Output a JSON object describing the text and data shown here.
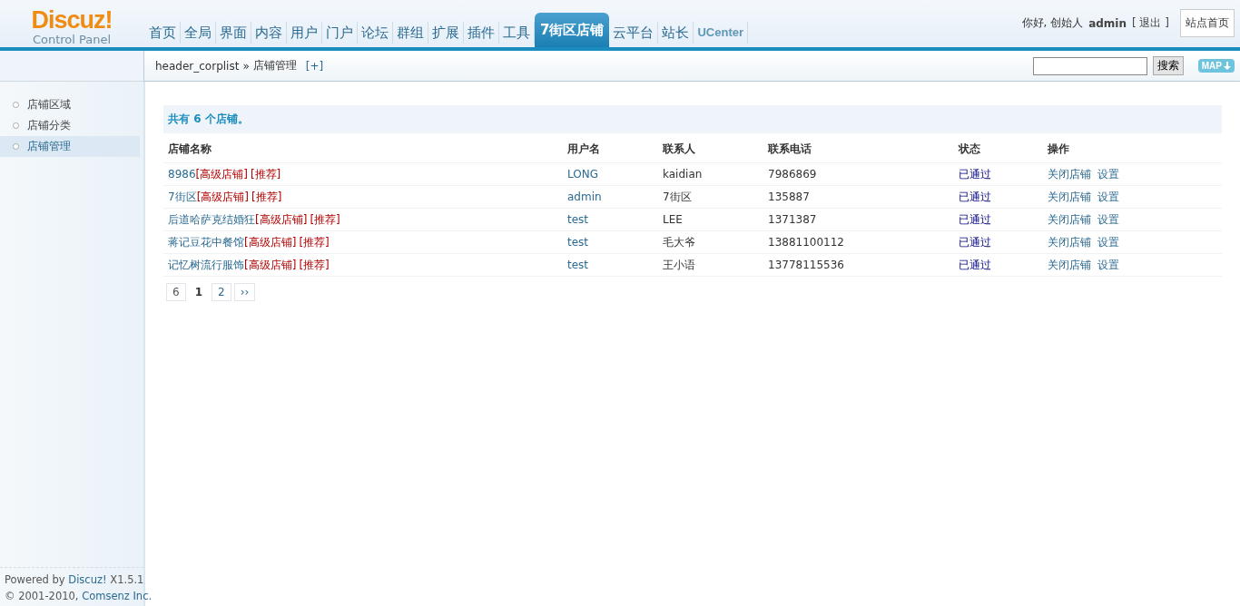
{
  "logo": {
    "title": "Discuz!",
    "subtitle": "Control Panel"
  },
  "nav_tabs": [
    {
      "label": "首页",
      "kind": "menu",
      "selected": false
    },
    {
      "label": "全局",
      "kind": "menu",
      "selected": false
    },
    {
      "label": "界面",
      "kind": "menu",
      "selected": false
    },
    {
      "label": "内容",
      "kind": "menu",
      "selected": false
    },
    {
      "label": "用户",
      "kind": "menu",
      "selected": false
    },
    {
      "label": "门户",
      "kind": "menu",
      "selected": false
    },
    {
      "label": "论坛",
      "kind": "menu",
      "selected": false
    },
    {
      "label": "群组",
      "kind": "menu",
      "selected": false
    },
    {
      "label": "扩展",
      "kind": "menu",
      "selected": false
    },
    {
      "label": "插件",
      "kind": "menu",
      "selected": false
    },
    {
      "label": "工具",
      "kind": "menu",
      "selected": false
    },
    {
      "label": "7街区店铺",
      "kind": "menu",
      "selected": true
    },
    {
      "label": "云平台",
      "kind": "menu",
      "selected": false
    },
    {
      "label": "站长",
      "kind": "menu",
      "selected": false
    },
    {
      "label": "UCenter",
      "kind": "app",
      "selected": false
    }
  ],
  "user_bar": {
    "greeting": "你好, 创始人",
    "username": "admin",
    "logout": "[ 退出 ]",
    "site_home": "站点首页"
  },
  "breadcrumb": {
    "path": "header_corplist",
    "separator": "»",
    "current": "店铺管理",
    "add": "[+]"
  },
  "search": {
    "button": "搜索",
    "map": "MAP"
  },
  "sidebar": {
    "items": [
      {
        "label": "店铺区域",
        "selected": false
      },
      {
        "label": "店铺分类",
        "selected": false
      },
      {
        "label": "店铺管理",
        "selected": true
      }
    ]
  },
  "footer": [
    [
      {
        "text": "Powered by ",
        "link": false
      },
      {
        "text": "Discuz!",
        "link": true
      },
      {
        "text": " X1.5.1",
        "link": false
      }
    ],
    [
      {
        "text": "© 2001-2010, ",
        "link": false
      },
      {
        "text": "Comsenz Inc.",
        "link": true
      }
    ]
  ],
  "summary": "共有 6 个店铺。",
  "table": {
    "columns": [
      "店铺名称",
      "用户名",
      "联系人",
      "联系电话",
      "状态",
      "操作"
    ],
    "rows": [
      {
        "name": "8986",
        "tags": [
          "[高级店铺]",
          "[推荐]"
        ],
        "user": "LONG",
        "contact": "kaidian",
        "phone": "7986869",
        "status": "已通过",
        "actions": [
          "关闭店铺",
          "设置"
        ]
      },
      {
        "name": "7街区",
        "tags": [
          "[高级店铺]",
          "[推荐]"
        ],
        "user": "admin",
        "contact": "7街区",
        "phone": "135887",
        "status": "已通过",
        "actions": [
          "关闭店铺",
          "设置"
        ]
      },
      {
        "name": "后道哈萨克结婚狂",
        "tags": [
          "[高级店铺]",
          "[推荐]"
        ],
        "user": "test",
        "contact": "LEE",
        "phone": "1371387",
        "status": "已通过",
        "actions": [
          "关闭店铺",
          "设置"
        ]
      },
      {
        "name": "蒋记豆花中餐馆",
        "tags": [
          "[高级店铺]",
          "[推荐]"
        ],
        "user": "test",
        "contact": "毛大爷",
        "phone": "13881100112",
        "status": "已通过",
        "actions": [
          "关闭店铺",
          "设置"
        ]
      },
      {
        "name": "记忆树流行服饰",
        "tags": [
          "[高级店铺]",
          "[推荐]"
        ],
        "user": "test",
        "contact": "王小语",
        "phone": "13778115536",
        "status": "已通过",
        "actions": [
          "关闭店铺",
          "设置"
        ]
      }
    ]
  },
  "pagination": {
    "total": "6",
    "pages": [
      {
        "label": "1",
        "selected": true
      },
      {
        "label": "2",
        "selected": false
      }
    ],
    "next": "››"
  }
}
